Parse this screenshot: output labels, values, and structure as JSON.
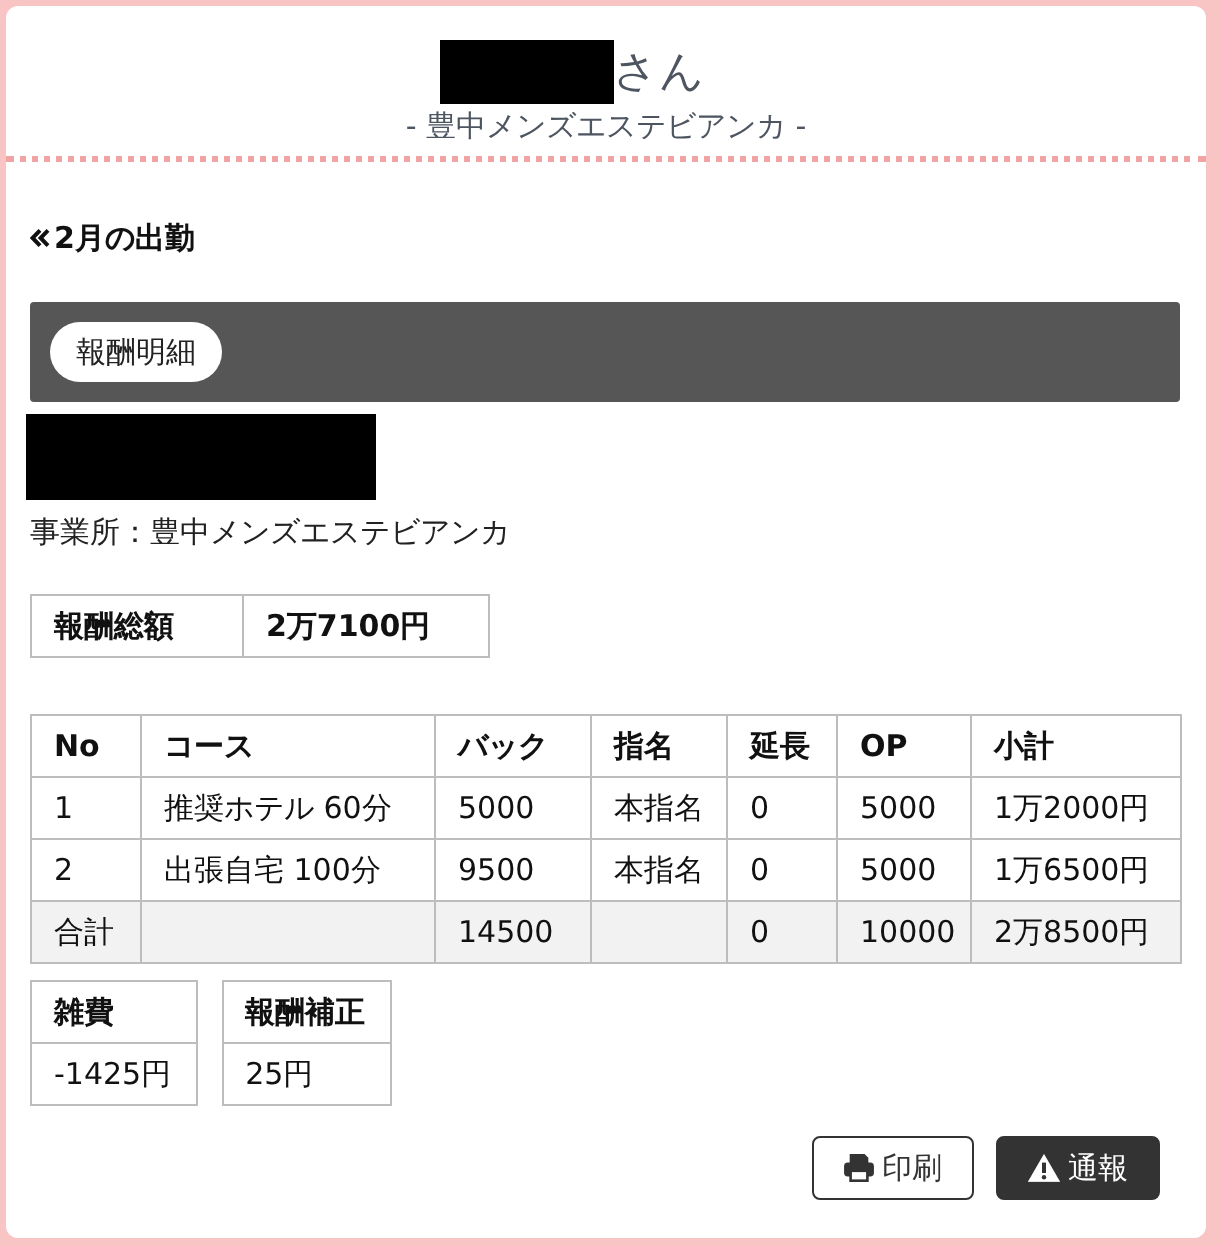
{
  "header": {
    "title_suffix": "さん",
    "subtitle": "- 豊中メンズエステビアンカ -"
  },
  "back_link": {
    "label": "2月の出勤"
  },
  "section": {
    "badge": "報酬明細"
  },
  "office": "事業所：豊中メンズエステビアンカ",
  "total": {
    "label": "報酬総額",
    "value": "2万7100円"
  },
  "table": {
    "columns": [
      "No",
      "コース",
      "バック",
      "指名",
      "延長",
      "OP",
      "小計"
    ],
    "rows": [
      {
        "kind": "item",
        "cells": [
          "1",
          "推奨ホテル 60分",
          "5000",
          "本指名",
          "0",
          "5000",
          "1万2000円"
        ]
      },
      {
        "kind": "item",
        "cells": [
          "2",
          "出張自宅 100分",
          "9500",
          "本指名",
          "0",
          "5000",
          "1万6500円"
        ]
      },
      {
        "kind": "total",
        "cells": [
          "合計",
          null,
          "14500",
          null,
          "0",
          "10000",
          "2万8500円"
        ]
      }
    ]
  },
  "adjustments": [
    {
      "label": "雑費",
      "value": "-1425円"
    },
    {
      "label": "報酬補正",
      "value": "25円"
    }
  ],
  "buttons": [
    {
      "kind": "print",
      "label": "印刷"
    },
    {
      "kind": "report",
      "label": "通報"
    }
  ]
}
